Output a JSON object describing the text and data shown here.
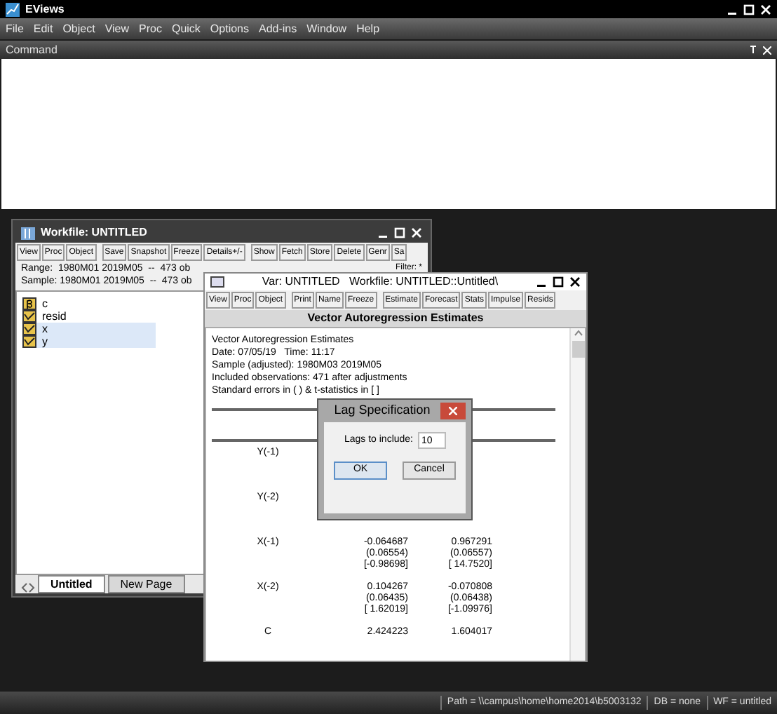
{
  "app": {
    "title": "EViews"
  },
  "menu": [
    "File",
    "Edit",
    "Object",
    "View",
    "Proc",
    "Quick",
    "Options",
    "Add-ins",
    "Window",
    "Help"
  ],
  "command_panel": {
    "title": "Command"
  },
  "workfile_window": {
    "title": "Workfile: UNTITLED",
    "toolbar": [
      "View",
      "Proc",
      "Object",
      "Save",
      "Snapshot",
      "Freeze",
      "Details+/-",
      "Show",
      "Fetch",
      "Store",
      "Delete",
      "Genr",
      "Sa"
    ],
    "range": "Range:  1980M01 2019M05  --  473 ob",
    "sample": "Sample: 1980M01 2019M05  --  473 ob",
    "filter": "Filter: *",
    "objects": [
      {
        "kind": "coef",
        "name": "c",
        "selected": false
      },
      {
        "kind": "series",
        "name": "resid",
        "selected": false
      },
      {
        "kind": "series",
        "name": "x",
        "selected": true
      },
      {
        "kind": "series",
        "name": "y",
        "selected": true
      }
    ],
    "tabs": [
      {
        "label": "Untitled",
        "selected": true
      },
      {
        "label": "New Page",
        "selected": false
      }
    ]
  },
  "var_window": {
    "title": "Var: UNTITLED   Workfile: UNTITLED::Untitled\\",
    "toolbar": [
      "View",
      "Proc",
      "Object",
      "Print",
      "Name",
      "Freeze",
      "Estimate",
      "Forecast",
      "Stats",
      "Impulse",
      "Resids"
    ],
    "header": "Vector Autoregression Estimates",
    "info": [
      "Vector Autoregression Estimates",
      "Date: 07/05/19   Time: 11:17",
      "Sample (adjusted): 1980M03 2019M05",
      "Included observations: 471 after adjustments",
      "Standard errors in ( ) & t-statistics in [ ]"
    ],
    "rows": [
      {
        "label": "Y(-1)",
        "values": []
      },
      {
        "label": "Y(-2)",
        "values": []
      },
      {
        "label": "X(-1)",
        "values": [
          [
            "-0.064687",
            "0.967291"
          ],
          [
            "(0.06554)",
            "(0.06557)"
          ],
          [
            "[-0.98698]",
            "[ 14.7520]"
          ]
        ]
      },
      {
        "label": "X(-2)",
        "values": [
          [
            "0.104267",
            "-0.070808"
          ],
          [
            "(0.06435)",
            "(0.06438)"
          ],
          [
            "[ 1.62019]",
            "[-1.09976]"
          ]
        ]
      },
      {
        "label": "C",
        "values": [
          [
            "2.424223",
            "1.604017"
          ]
        ]
      }
    ]
  },
  "dialog": {
    "title": "Lag Specification",
    "field_label": "Lags to include:",
    "value": "10",
    "buttons": [
      "OK",
      "Cancel"
    ]
  },
  "status_bar": [
    "Path = \\\\campus\\home\\home2014\\b5003132",
    "DB = none",
    "WF = untitled"
  ]
}
